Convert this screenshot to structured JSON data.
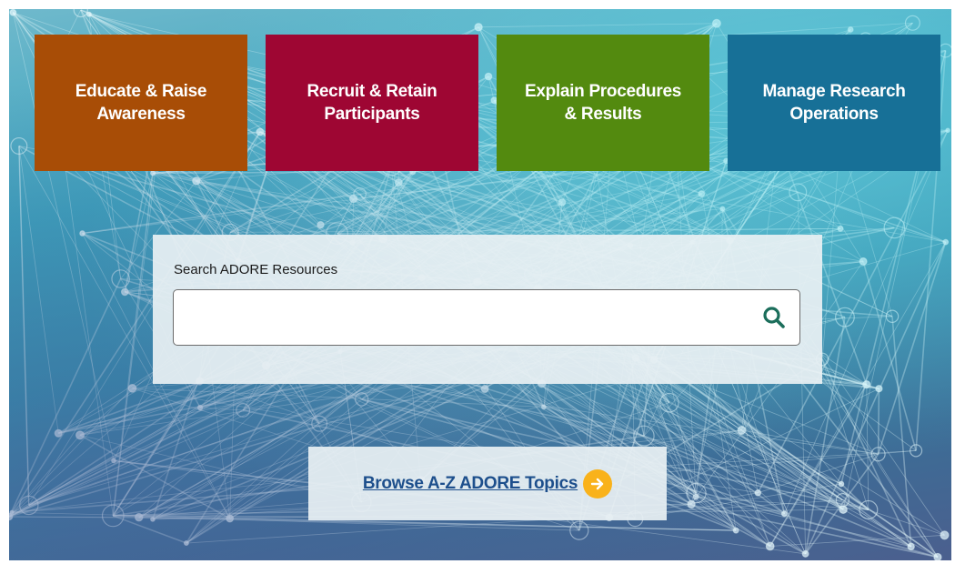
{
  "tiles": [
    {
      "line1": "Educate & Raise",
      "line2": "Awareness",
      "color": "#a84d06"
    },
    {
      "line1": "Recruit & Retain",
      "line2": "Participants",
      "color": "#9e0633"
    },
    {
      "line1": "Explain Procedures",
      "line2": "& Results",
      "color": "#538a0f"
    },
    {
      "line1": "Manage Research",
      "line2": "Operations",
      "color": "#177097"
    }
  ],
  "search": {
    "label": "Search ADORE Resources",
    "value": "",
    "placeholder": "",
    "icon": "search-icon",
    "icon_color": "#1b6e5b"
  },
  "browse": {
    "label": "Browse A-Z ADORE Topics",
    "icon": "arrow-right-circle-icon",
    "icon_color": "#f9b21b"
  },
  "colors": {
    "panel_bg": "#e8f0f3",
    "link": "#1d4f8c"
  }
}
